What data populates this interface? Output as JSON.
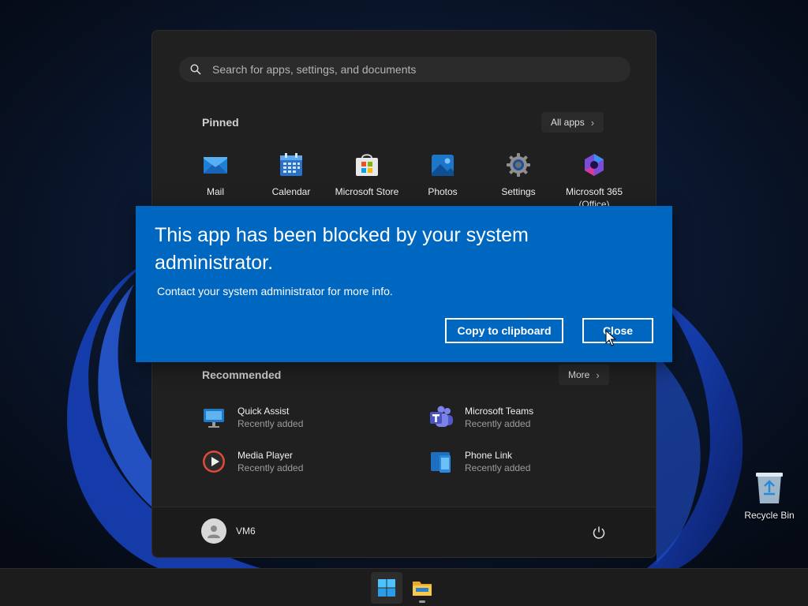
{
  "start_menu": {
    "search": {
      "placeholder": "Search for apps, settings, and documents"
    },
    "pinned": {
      "title": "Pinned",
      "all_apps_label": "All apps",
      "apps": [
        {
          "label": "Mail",
          "icon": "mail-icon"
        },
        {
          "label": "Calendar",
          "icon": "calendar-icon"
        },
        {
          "label": "Microsoft Store",
          "icon": "store-icon"
        },
        {
          "label": "Photos",
          "icon": "photos-icon"
        },
        {
          "label": "Settings",
          "icon": "gear-icon"
        },
        {
          "label": "Microsoft 365\n(Office)",
          "icon": "office-icon"
        }
      ]
    },
    "recommended": {
      "title": "Recommended",
      "more_label": "More",
      "items": [
        {
          "name": "Quick Assist",
          "sub": "Recently added",
          "icon": "quick-assist-icon"
        },
        {
          "name": "Microsoft Teams",
          "sub": "Recently added",
          "icon": "teams-icon"
        },
        {
          "name": "Media Player",
          "sub": "Recently added",
          "icon": "media-player-icon"
        },
        {
          "name": "Phone Link",
          "sub": "Recently added",
          "icon": "phone-link-icon"
        }
      ]
    },
    "user": {
      "name": "VM6"
    }
  },
  "dialog": {
    "title": "This app has been blocked by your system administrator.",
    "message": "Contact your system administrator for more info.",
    "copy_label": "Copy to clipboard",
    "close_label": "Close"
  },
  "desktop": {
    "recycle_bin_label": "Recycle Bin"
  },
  "colors": {
    "dialog_bg": "#0067c0",
    "menu_bg": "#202020",
    "taskbar_bg": "#1c1c1c"
  }
}
